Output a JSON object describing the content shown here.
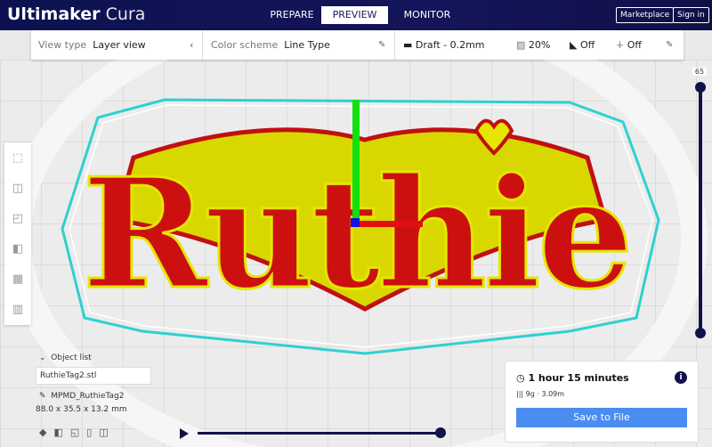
{
  "app": {
    "brand": "Ultimaker",
    "product": "Cura"
  },
  "tabs": [
    {
      "label": "PREPARE"
    },
    {
      "label": "PREVIEW",
      "active": true
    },
    {
      "label": "MONITOR"
    }
  ],
  "header_buttons": {
    "marketplace": "Marketplace",
    "signin": "Sign in"
  },
  "toolbar": {
    "view_type_label": "View type",
    "view_type_value": "Layer view",
    "color_scheme_label": "Color scheme",
    "color_scheme_value": "Line Type",
    "profile": "Draft - 0.2mm",
    "infill": "20%",
    "support": "Off",
    "adhesion": "Off"
  },
  "layer": {
    "current": "65"
  },
  "model": {
    "text": "Ruthie"
  },
  "object_list": {
    "title": "Object list",
    "file": "RuthieTag2.stl",
    "job_name": "MPMD_RuthieTag2",
    "dimensions": "88.0 x 35.5 x 13.2 mm"
  },
  "print_info": {
    "time": "1 hour 15 minutes",
    "material": "9g · 3.09m",
    "save_label": "Save to File"
  },
  "playback": {
    "progress": 1.0
  },
  "colors": {
    "header": "#12145a",
    "accent": "#4b8cf0",
    "wall": "#d01010",
    "infill": "#e6e600",
    "skirt": "#30d0d0"
  }
}
